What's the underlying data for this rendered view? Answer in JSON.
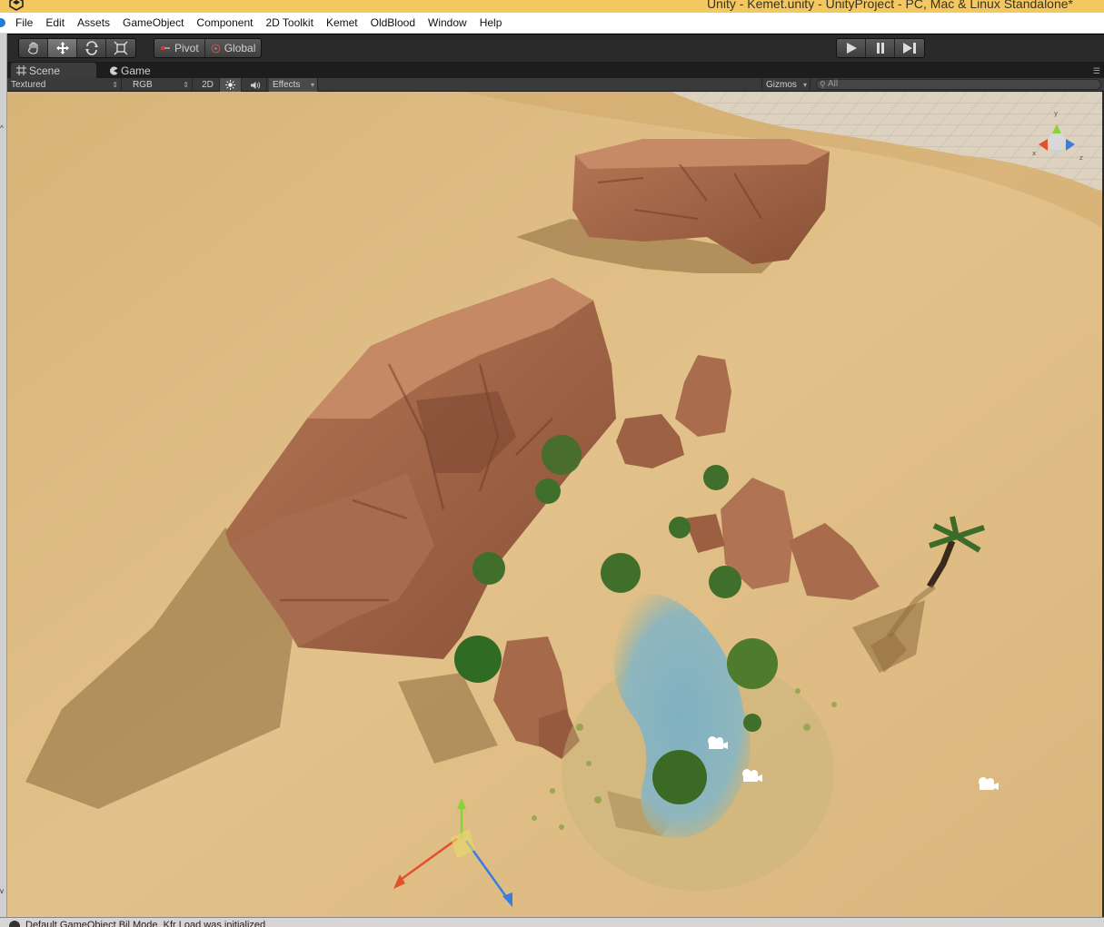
{
  "window": {
    "title": "Unity - Kemet.unity - UnityProject - PC, Mac & Linux Standalone*"
  },
  "menu": {
    "items": [
      "File",
      "Edit",
      "Assets",
      "GameObject",
      "Component",
      "2D Toolkit",
      "Kemet",
      "OldBlood",
      "Window",
      "Help"
    ]
  },
  "toolbar": {
    "tools": [
      {
        "name": "hand-tool",
        "icon": "hand-icon",
        "active": false
      },
      {
        "name": "move-tool",
        "icon": "move-icon",
        "active": true
      },
      {
        "name": "rotate-tool",
        "icon": "rotate-icon",
        "active": false
      },
      {
        "name": "scale-tool",
        "icon": "scale-icon",
        "active": false
      }
    ],
    "pivot_label": "Pivot",
    "global_label": "Global",
    "play_icons": [
      "play-icon",
      "pause-icon",
      "step-icon"
    ]
  },
  "tabs": {
    "scene_label": "Scene",
    "game_label": "Game"
  },
  "scenebar": {
    "render_mode": "Textured",
    "color_mode": "RGB",
    "mode_2d": "2D",
    "effects_label": "Effects",
    "gizmos_label": "Gizmos",
    "search_placeholder": "All"
  },
  "colors": {
    "title_bar": "#f3c860",
    "sand": "#dcb97c",
    "rock": "#a8674a",
    "water": "#8fb6c0",
    "axis_x": "#e0512c",
    "axis_y": "#8ad23a",
    "axis_z": "#3a7de0"
  },
  "statusbar": {
    "message": "Default GameObject Bil Mode_Kfr Load was initialized"
  }
}
